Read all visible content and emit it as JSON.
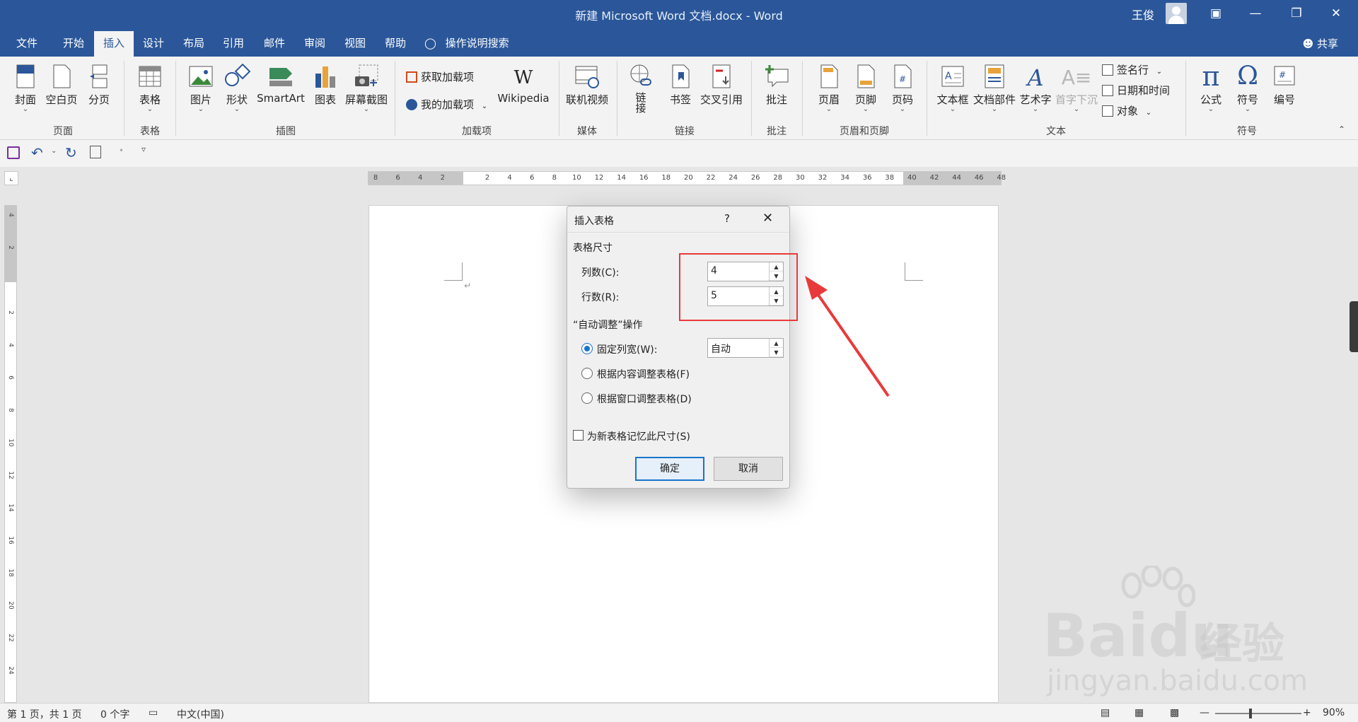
{
  "window": {
    "title": "新建 Microsoft Word 文档.docx  -  Word",
    "user": "王俊",
    "controls": [
      "minimize-ribbon",
      "minimize",
      "restore",
      "close"
    ]
  },
  "tabs": [
    "文件",
    "开始",
    "插入",
    "设计",
    "布局",
    "引用",
    "邮件",
    "审阅",
    "视图",
    "帮助"
  ],
  "active_tab": "插入",
  "tell_me": "操作说明搜索",
  "share": "共享",
  "ribbon": {
    "page": {
      "label": "页面",
      "cover": "封面",
      "blank": "空白页",
      "break": "分页"
    },
    "table": {
      "label": "表格",
      "table": "表格"
    },
    "illustrations": {
      "label": "插图",
      "picture": "图片",
      "shapes": "形状",
      "smartart": "SmartArt",
      "chart": "图表",
      "screenshot": "屏幕截图"
    },
    "addins": {
      "label": "加载项",
      "get": "获取加载项",
      "mine": "我的加载项",
      "wiki": "Wikipedia"
    },
    "media": {
      "label": "媒体",
      "video": "联机视频"
    },
    "links": {
      "label": "链接",
      "link": "链接",
      "bookmark": "书签",
      "crossref": "交叉引用"
    },
    "comments": {
      "label": "批注",
      "comment": "批注"
    },
    "header_footer": {
      "label": "页眉和页脚",
      "header": "页眉",
      "footer": "页脚",
      "page_number": "页码"
    },
    "text": {
      "label": "文本",
      "textbox": "文本框",
      "quickparts": "文档部件",
      "wordart": "艺术字",
      "dropcap": "首字下沉",
      "signature": "签名行",
      "datetime": "日期和时间",
      "object": "对象"
    },
    "symbols": {
      "label": "符号",
      "equation": "公式",
      "symbol": "符号",
      "number": "编号"
    }
  },
  "ruler": {
    "ticks": [
      "8",
      "6",
      "4",
      "2",
      "",
      "2",
      "4",
      "6",
      "8",
      "10",
      "12",
      "14",
      "16",
      "18",
      "20",
      "22",
      "24",
      "26",
      "28",
      "30",
      "32",
      "34",
      "36",
      "38",
      "40",
      "42",
      "44",
      "46",
      "48"
    ]
  },
  "vruler": {
    "ticks": [
      "4",
      "2",
      "",
      "2",
      "4",
      "6",
      "8",
      "10",
      "12",
      "14",
      "16",
      "18",
      "20",
      "22",
      "24"
    ]
  },
  "dialog": {
    "title": "插入表格",
    "help": "?",
    "close": "✕",
    "size_section": "表格尺寸",
    "cols_label": "列数(C):",
    "cols_value": "4",
    "rows_label": "行数(R):",
    "rows_value": "5",
    "autofit_section": "“自动调整”操作",
    "fixed_label": "固定列宽(W):",
    "fixed_value": "自动",
    "content_label": "根据内容调整表格(F)",
    "window_label": "根据窗口调整表格(D)",
    "remember_label": "为新表格记忆此尺寸(S)",
    "ok": "确定",
    "cancel": "取消",
    "selected_autofit": "fixed",
    "remember_checked": false
  },
  "status": {
    "page": "第 1 页，共 1 页",
    "words": "0 个字",
    "language": "中文(中国)",
    "zoom": "90%"
  },
  "watermark": {
    "brand": "Bai",
    "brand_suffix": "du",
    "jy": "经验",
    "url": "jingyan.baidu.com"
  },
  "colors": {
    "accent": "#2b579a",
    "highlight": "#e83a3a"
  }
}
